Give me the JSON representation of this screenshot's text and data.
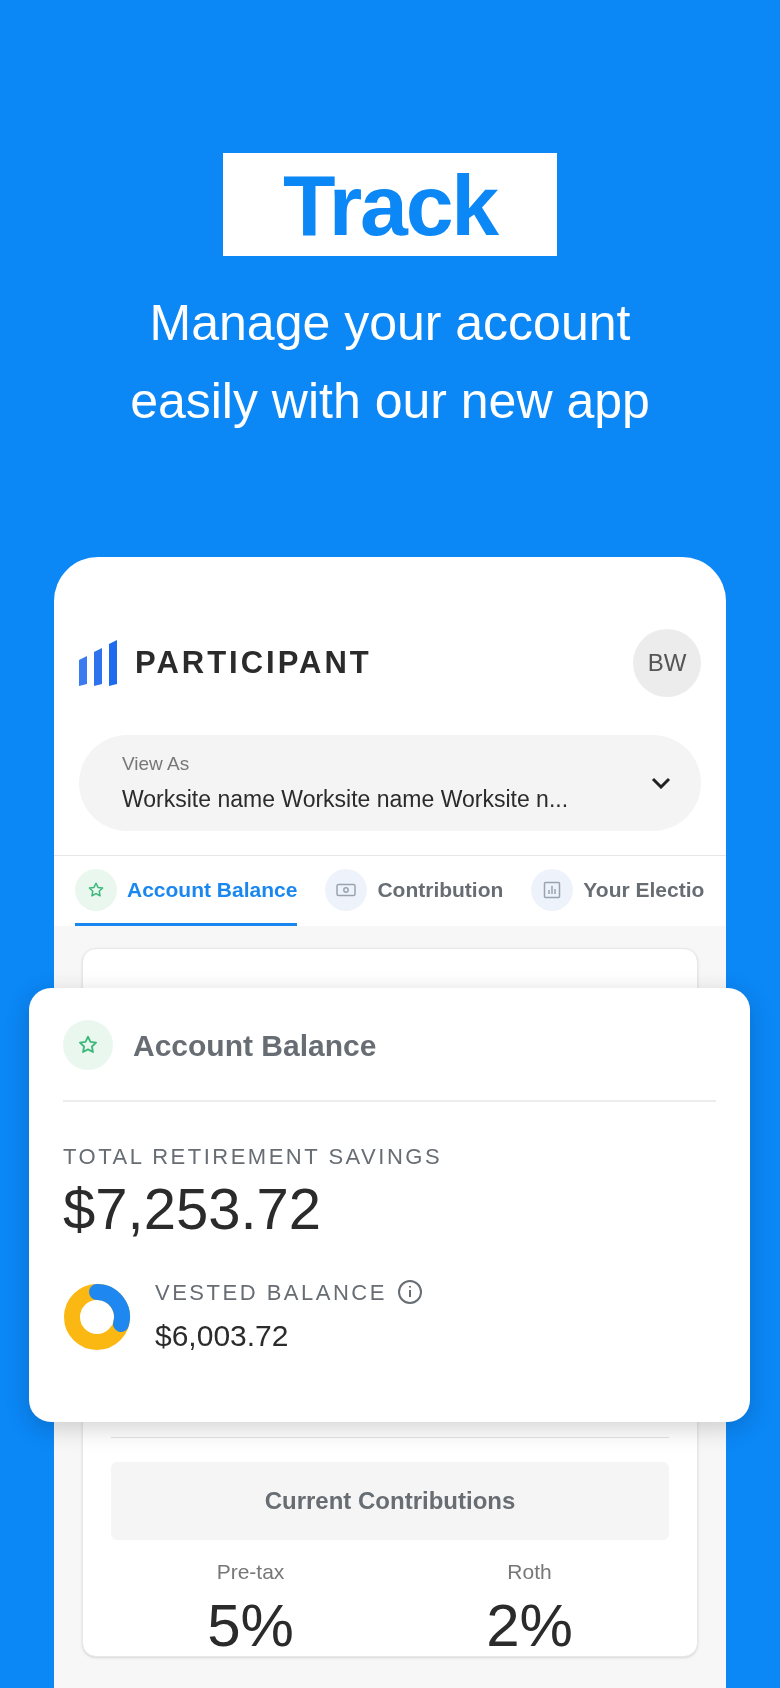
{
  "promo": {
    "headline": "Track",
    "subtitle_lines": [
      "Manage your account",
      "easily with our new app"
    ]
  },
  "app": {
    "logo": "PARTICIPANT",
    "avatar": "BW",
    "view_as": {
      "label": "View As",
      "value": "Worksite name Worksite name Worksite n..."
    },
    "tabs": [
      {
        "label": "Account Balance",
        "selected": true
      },
      {
        "label": "Contribution",
        "selected": false
      },
      {
        "label": "Your Electio",
        "selected": false
      }
    ],
    "balance_card": {
      "title": "Account Balance",
      "total_label": "TOTAL RETIREMENT SAVINGS",
      "total": "$7,253.72",
      "vested_label": "VESTED BALANCE",
      "vested": "$6,003.72"
    },
    "contributions": {
      "title": "Current Contributions",
      "items": [
        {
          "label": "Pre-tax",
          "value": "5%"
        },
        {
          "label": "Roth",
          "value": "2%"
        }
      ]
    }
  }
}
